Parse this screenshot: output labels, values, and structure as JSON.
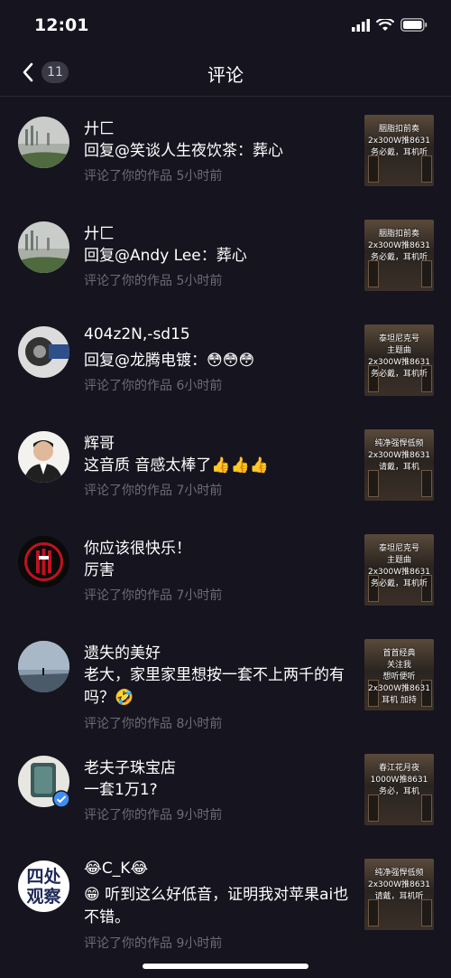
{
  "status": {
    "time": "12:01"
  },
  "nav": {
    "title": "评论",
    "badge": "11"
  },
  "items": [
    {
      "name": "廾匚",
      "reply": "回复@笑谈人生夜饮茶：葬心",
      "meta": "评论了你的作品 5小时前",
      "thumb_text": "胭脂扣前奏\n2x300W推8631\n务必戴，耳机听",
      "avatar": "lake"
    },
    {
      "name": "廾匚",
      "reply": "回复@Andy Lee：葬心",
      "meta": "评论了你的作品 5小时前",
      "thumb_text": "胭脂扣前奏\n2x300W推8631\n务必戴，耳机听",
      "avatar": "lake"
    },
    {
      "name": "404z2N,-sd15",
      "reply": "回复@龙腾电镀：😳😳😳",
      "meta": "评论了你的作品 6小时前",
      "thumb_text": "泰坦尼克号\n主题曲\n2x300W推8631\n务必戴，耳机听",
      "avatar": "mech"
    },
    {
      "name": "辉哥",
      "reply": "这音质 音感太棒了👍👍👍",
      "meta": "评论了你的作品 7小时前",
      "thumb_text": "纯净强悍低频\n2x300W推8631\n请戴，耳机",
      "avatar": "person"
    },
    {
      "name": "你应该很快乐！",
      "reply": "厉害",
      "meta": "评论了你的作品 7小时前",
      "thumb_text": "泰坦尼克号\n主题曲\n2x300W推8631\n务必戴，耳机听",
      "avatar": "acmilan"
    },
    {
      "name": "遗失的美好",
      "reply": "老大，家里家里想按一套不上两千的有吗？🤣",
      "meta": "评论了你的作品 8小时前",
      "thumb_text": "首首经典\n关注我\n想听便听\n2x300W推8631\n耳机 加持",
      "avatar": "sky",
      "tall": true
    },
    {
      "name": "老夫子珠宝店",
      "reply": "一套1万1?",
      "meta": "评论了你的作品 9小时前",
      "thumb_text": "春江花月夜\n1000W推8631\n务必，耳机",
      "avatar": "jewel"
    },
    {
      "name": "😂C_K😂",
      "reply": "😁 听到这么好低音，证明我对苹果ai也不错。",
      "meta": "评论了你的作品 9小时前",
      "thumb_text": "纯净强悍低频\n2x300W推8631\n请戴，耳机听",
      "avatar": "text",
      "avatar_text": "四处观察",
      "tall": true
    }
  ]
}
